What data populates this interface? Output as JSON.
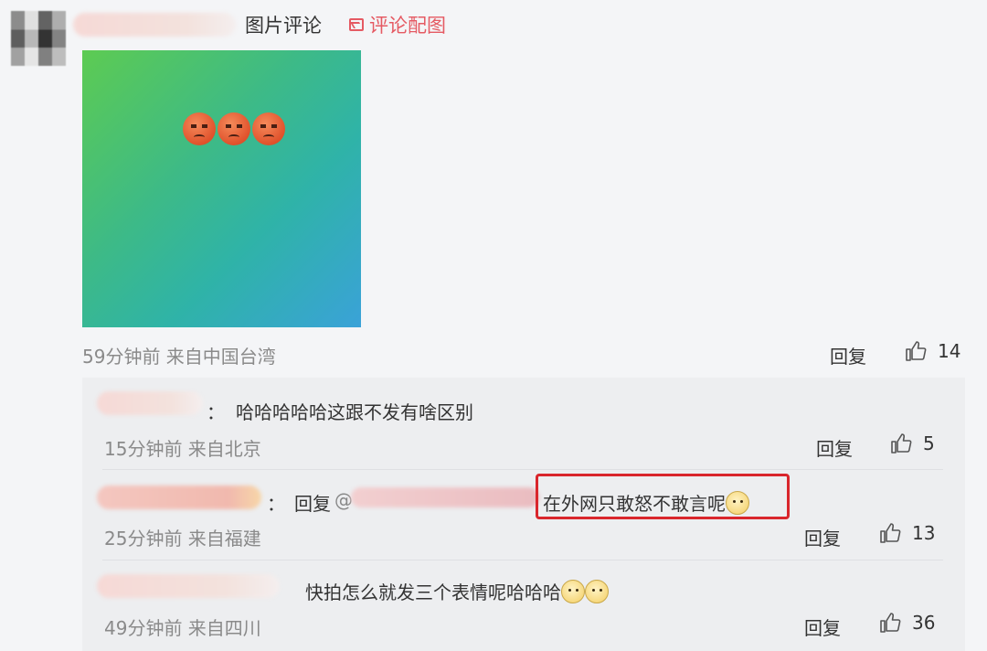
{
  "post": {
    "title": "图片评论",
    "attach_label": "评论配图",
    "emoji_icons": [
      "angry-face",
      "angry-face",
      "angry-face"
    ],
    "meta": "59分钟前  来自中国台湾",
    "reply_label": "回复",
    "likes": "14"
  },
  "replies": [
    {
      "prefix": "：",
      "text": "哈哈哈哈哈这跟不发有啥区别",
      "meta": "15分钟前  来自北京",
      "reply_label": "回复",
      "likes": "5"
    },
    {
      "prefix": "：",
      "reply_word": "回复",
      "at": "@",
      "text": "在外网只敢怒不敢言呢",
      "meta": "25分钟前  来自福建",
      "reply_label": "回复",
      "likes": "13"
    },
    {
      "text": "快拍怎么就发三个表情呢哈哈哈",
      "meta": "49分钟前  来自四川",
      "reply_label": "回复",
      "likes": "36"
    }
  ],
  "colors": {
    "accent": "#e55a63",
    "highlight": "#d9262c",
    "background": "#f4f5f7",
    "reply_background": "#edeef0"
  }
}
